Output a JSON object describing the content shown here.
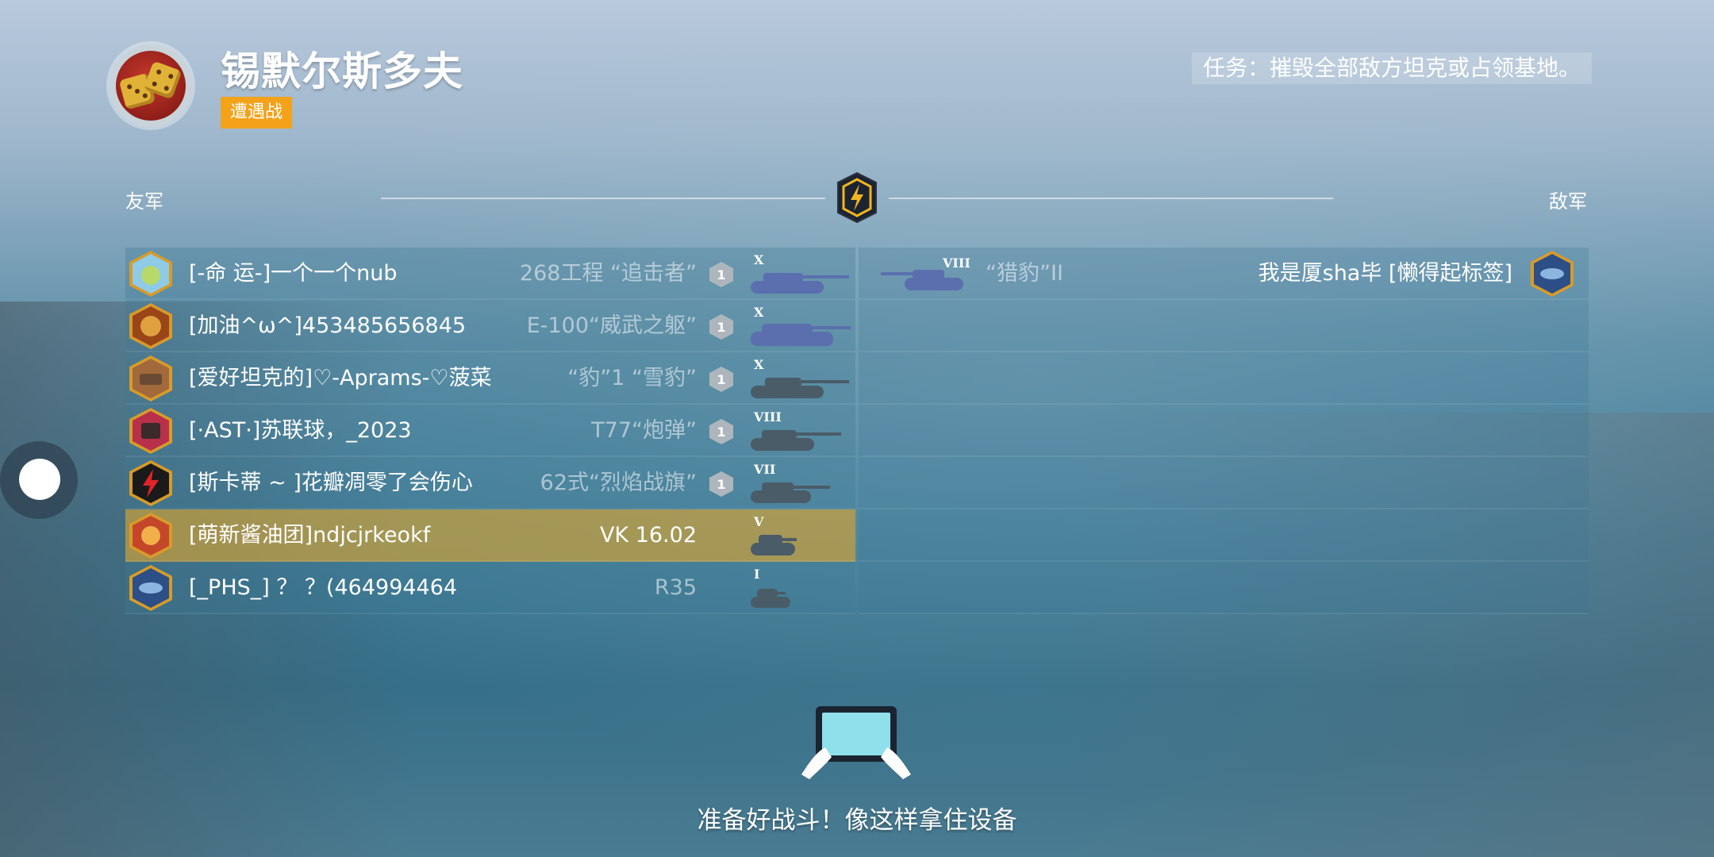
{
  "header": {
    "map_name": "锡默尔斯多夫",
    "mode": "遭遇战",
    "mission": "任务：摧毁全部敌方坦克或占领基地。"
  },
  "teams": {
    "ally_label": "友军",
    "enemy_label": "敌军"
  },
  "allies": [
    {
      "name": "[-命 运-]一个一个nub",
      "tank": "268工程 “追击者”",
      "tier": "X",
      "badge": "1",
      "tank_color": "#5b6fae"
    },
    {
      "name": "[加油^ω^]453485656845",
      "tank": "E-100“威武之躯”",
      "tier": "X",
      "badge": "1",
      "tank_color": "#5b6fae"
    },
    {
      "name": "[爱好坦克的]♡-Aprams-♡菠菜",
      "tank": "“豹”1 “雪豹”",
      "tier": "X",
      "badge": "1",
      "tank_color": "#4a5c68"
    },
    {
      "name": "[·AST·]苏联球，_2023",
      "tank": "T77“炮弹”",
      "tier": "VIII",
      "badge": "1",
      "tank_color": "#4a5c68"
    },
    {
      "name": "[斯卡蒂 ~ ]花瓣凋零了会伤心",
      "tank": "62式“烈焰战旗”",
      "tier": "VII",
      "badge": "1",
      "tank_color": "#4a5c68"
    },
    {
      "name": "[萌新酱油团]ndjcjrkeokf",
      "tank": "VK 16.02",
      "tier": "V",
      "badge": "",
      "tank_color": "#4a5c68",
      "is_self": true
    },
    {
      "name": "[_PHS_] ？ ？(464994464",
      "tank": "R35",
      "tier": "I",
      "badge": "",
      "tank_color": "#4a5c68"
    }
  ],
  "enemies": [
    {
      "name": "我是厦sha毕 [懒得起标签]",
      "tank": "“猎豹”II",
      "tier": "VIII",
      "tank_color": "#5b6fae"
    }
  ],
  "footer": {
    "ready_text": "准备好战斗！像这样拿住设备"
  }
}
